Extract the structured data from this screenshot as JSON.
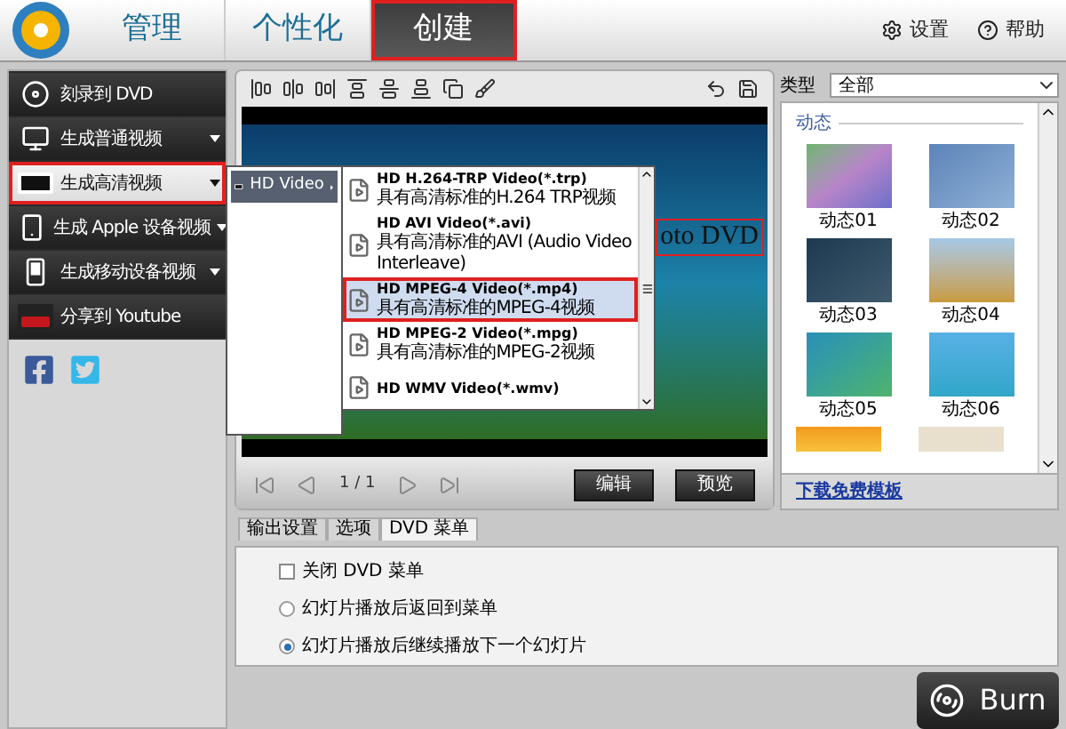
{
  "header": {
    "tabs": [
      {
        "label": "管理",
        "selected": false,
        "highlighted": false
      },
      {
        "label": "个性化",
        "selected": false,
        "highlighted": false
      },
      {
        "label": "创建",
        "selected": true,
        "highlighted": true
      }
    ],
    "links": [
      "设置",
      "帮助"
    ]
  },
  "sidebar": {
    "items": [
      {
        "label": "刻录到 DVD",
        "has_submenu": false,
        "selected": false,
        "highlighted": false
      },
      {
        "label": "生成普通视频",
        "has_submenu": true,
        "selected": false,
        "highlighted": false
      },
      {
        "label": "生成高清视频",
        "has_submenu": true,
        "selected": true,
        "highlighted": true
      },
      {
        "label": "生成 Apple 设备视频",
        "has_submenu": true,
        "selected": false,
        "highlighted": false
      },
      {
        "label": "生成移动设备视频",
        "has_submenu": true,
        "selected": false,
        "highlighted": false
      },
      {
        "label": "分享到 Youtube",
        "has_submenu": false,
        "selected": false,
        "highlighted": false
      }
    ]
  },
  "flyout": {
    "categories": [
      {
        "label": "HD Video",
        "selected": true
      }
    ],
    "formats": [
      {
        "title": "HD H.264-TRP Video(*.trp)",
        "description": "具有高清标准的H.264 TRP视频",
        "selected": false,
        "highlighted": false
      },
      {
        "title": "HD AVI Video(*.avi)",
        "description": "具有高清标准的AVI (Audio Video Interleave)",
        "selected": false,
        "highlighted": false
      },
      {
        "title": "HD MPEG-4 Video(*.mp4)",
        "description": "具有高清标准的MPEG-4视频",
        "selected": true,
        "highlighted": true
      },
      {
        "title": "HD MPEG-2 Video(*.mpg)",
        "description": "具有高清标准的MPEG-2视频",
        "selected": false,
        "highlighted": false
      },
      {
        "title": "HD WMV Video(*.wmv)",
        "selected": false,
        "highlighted": false
      }
    ]
  },
  "preview": {
    "title": "oto DVD",
    "page": "1 / 1",
    "buttons": [
      "编辑",
      "预览"
    ]
  },
  "templates": {
    "type_label": "类型",
    "type_value": "全部",
    "section": "动态",
    "items": [
      {
        "label": "动态01"
      },
      {
        "label": "动态02"
      },
      {
        "label": "动态03"
      },
      {
        "label": "动态04"
      },
      {
        "label": "动态05"
      },
      {
        "label": "动态06"
      }
    ],
    "download_link": "下载免费模板"
  },
  "bottom_tabs": [
    {
      "label": "输出设置",
      "selected": false
    },
    {
      "label": "选项",
      "selected": false
    },
    {
      "label": "DVD 菜单",
      "selected": true
    }
  ],
  "menu_options": {
    "close_menu": {
      "label": "关闭 DVD 菜单",
      "checked": false
    },
    "after_slideshow": [
      {
        "label": "幻灯片播放后返回到菜单",
        "selected": false
      },
      {
        "label": "幻灯片播放后继续播放下一个幻灯片",
        "selected": true
      }
    ]
  },
  "burn_button": "Burn"
}
